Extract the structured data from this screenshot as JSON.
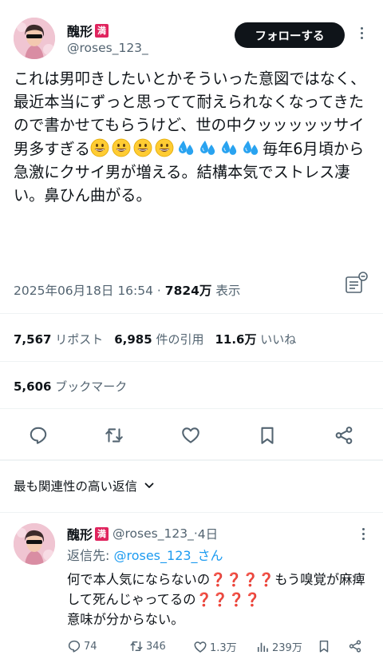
{
  "tweet": {
    "author": {
      "display_name": "醜形",
      "badge": "満",
      "handle": "@roses_123_"
    },
    "follow_label": "フォローする",
    "text_before": "これは男叩きしたいとかそういった意図ではなく、最近本当にずっと思ってて耐えられなくなってきたので書かせてもらうけど、世の中クッッッッッサイ男多すぎる",
    "text_after": "毎年6月頃から急激にクサイ男が増える。結構本気でストレス凄い。鼻ひん曲がる。",
    "timestamp": "2025年06月18日 16:54",
    "separator": " · ",
    "views": "7824万",
    "views_label": " 表示",
    "emoji_groups": [
      {
        "icon": "grinning-face-emoji",
        "count": 4
      },
      {
        "icon": "sweat-droplets-emoji",
        "count": 4
      }
    ]
  },
  "stats": {
    "reposts": "7,567",
    "reposts_label": " リポスト",
    "quotes": "6,985",
    "quotes_label": " 件の引用",
    "likes": "11.6万",
    "likes_label": " いいね",
    "bookmarks": "5,606",
    "bookmarks_label": " ブックマーク"
  },
  "section": {
    "label": "最も関連性の高い返信"
  },
  "reply": {
    "display_name": "醜形",
    "badge": "満",
    "handle": "@roses_123_",
    "dot": " · ",
    "time": "4日",
    "reply_to_label": "返信先: ",
    "reply_to_handle": "@roses_123_さん",
    "text_1": "何で本人気にならないの",
    "text_2": "もう嗅覚が麻痺して死んじゃってるの",
    "text_3": "意味が分からない。",
    "qmarks": "❓❓❓❓",
    "actions": {
      "replies": "74",
      "reposts": "346",
      "likes": "1.3万",
      "views": "239万"
    }
  },
  "colors": {
    "text": "#0f1419",
    "secondary": "#536471",
    "link": "#1d9bf0",
    "badge": "#e0245e"
  }
}
